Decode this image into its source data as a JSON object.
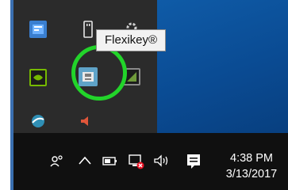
{
  "tooltip": {
    "text": "Flexikey®"
  },
  "overflow_icons": [
    {
      "name": "network-settings-icon",
      "color": "#3a7fd0"
    },
    {
      "name": "usb-drive-icon",
      "color": "#dcdcdc"
    },
    {
      "name": "gear-app-icon",
      "color": "#cfcfcf"
    },
    {
      "name": "nvidia-icon",
      "color": "#76b900"
    },
    {
      "name": "flexikey-icon",
      "color": "#5fa3c8"
    },
    {
      "name": "graphics-app-icon",
      "color": "#6f9a3a"
    },
    {
      "name": "sphere-app-icon",
      "color": "#2f8fb5"
    },
    {
      "name": "audio-speaker-app-icon",
      "color": "#e0563a"
    }
  ],
  "highlight_color": "#22d42a",
  "taskbar": {
    "people_glyph": "☑",
    "chevron_glyph": "^",
    "battery_glyph": "▭",
    "network_glyph": "□",
    "volume_glyph": "🔈",
    "action_center_glyph": "▤"
  },
  "clock": {
    "time": "4:38 PM",
    "date": "3/13/2017"
  }
}
